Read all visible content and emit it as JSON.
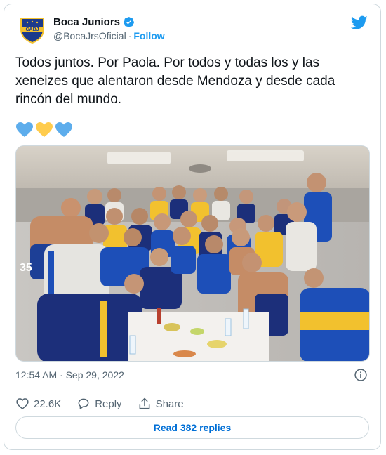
{
  "author": {
    "display_name": "Boca Juniors",
    "handle": "@BocaJrsOficial",
    "separator": "·",
    "follow_label": "Follow",
    "avatar_text": "CABJ"
  },
  "tweet": {
    "text": "Todos juntos. Por Paola. Por todos y todas los y las xeneizes que alentaron desde Mendoza y desde cada rincón del mundo.",
    "emojis": [
      "blue-heart-icon",
      "yellow-heart-icon",
      "blue-heart-icon"
    ]
  },
  "meta": {
    "timestamp": "12:54 AM · Sep 29, 2022"
  },
  "actions": {
    "likes": "22.6K",
    "reply_label": "Reply",
    "share_label": "Share"
  },
  "read_replies_label": "Read 382 replies",
  "colors": {
    "twitter_blue": "#1d9bf0",
    "link_blue": "#006fd6",
    "boca_blue": "#1b3a8c",
    "boca_gold": "#f2c12e",
    "heart_blue": "#5dadec",
    "heart_yellow": "#ffcc4d"
  }
}
